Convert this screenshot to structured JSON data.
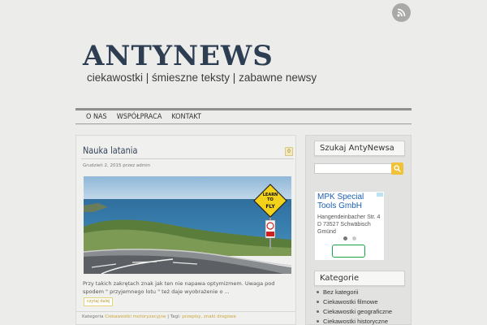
{
  "site": {
    "title": "ANTYNEWS",
    "tagline": "ciekawostki | śmieszne teksty | zabawne newsy"
  },
  "icons": {
    "rss": "rss-icon",
    "search": "search-icon",
    "comment": "comment-icon"
  },
  "nav": {
    "items": [
      {
        "label": "O NAS"
      },
      {
        "label": "WSPÓŁPRACA"
      },
      {
        "label": "KONTAKT"
      }
    ]
  },
  "post": {
    "title": "Nauka latania",
    "comments": "0",
    "date": "Grudzień 2, 2015 przez admin",
    "sign_text": "LEARN TO FLY",
    "excerpt": "Przy takich zakrętach znak jak ten nie napawa optymizmem. Uwaga pod spodem \" przyjemnego lotu \" też daje wyobrażenie o ...",
    "read_more": "czytaj dalej",
    "footer": {
      "category_label": "Kategoria",
      "category": "Ciekawostki motoryzacyjne",
      "tags_label": "| Tagi:",
      "tags": "przepisy, znaki drogowe"
    }
  },
  "sidebar": {
    "search_title": "Szukaj AntyNewsa",
    "search_value": "",
    "ad": {
      "title": "MPK Special Tools GmbH",
      "address": "Hangendeinbacher Str. 4 D 73527 Schwäbisch Gmünd"
    },
    "categories_title": "Kategorie",
    "categories": [
      {
        "label": "Bez kategorii"
      },
      {
        "label": "Ciekawostki filmowe"
      },
      {
        "label": "Ciekawostki geograficzne"
      },
      {
        "label": "Ciekawostki historyczne"
      }
    ]
  },
  "colors": {
    "background": "#ececea",
    "title": "#2e3e52",
    "accent": "#f0c23a",
    "ad_link": "#1a5fb4"
  }
}
